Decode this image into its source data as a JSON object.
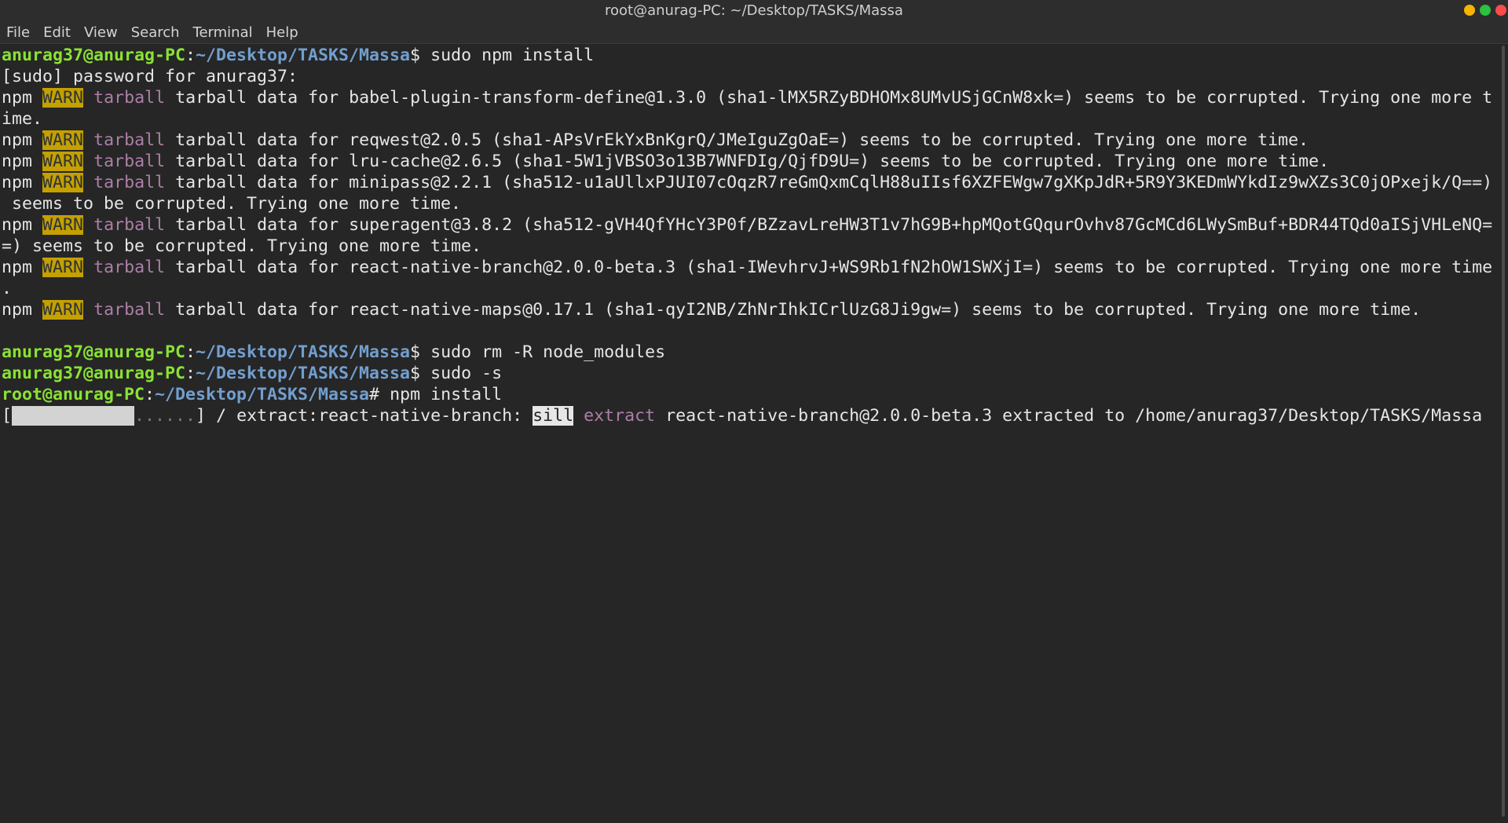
{
  "window": {
    "title": "root@anurag-PC: ~/Desktop/TASKS/Massa",
    "controls": [
      {
        "name": "minimize",
        "color": "#f7b500"
      },
      {
        "name": "maximize",
        "color": "#29c241"
      },
      {
        "name": "close",
        "color": "#fd4b4b"
      }
    ]
  },
  "menu": [
    "File",
    "Edit",
    "View",
    "Search",
    "Terminal",
    "Help"
  ],
  "colors": {
    "user_prompt": "#8ae234",
    "path": "#729fcf",
    "warn_bg": "#c4a000",
    "tarball": "#ad7fa8"
  },
  "terminal": {
    "lines": [
      {
        "type": "prompt",
        "user": "anurag37@anurag-PC",
        "path": "~/Desktop/TASKS/Massa",
        "symbol": "$",
        "cmd": " sudo npm install"
      },
      {
        "type": "plain",
        "text": "[sudo] password for anurag37:"
      },
      {
        "type": "warn",
        "pre": "npm",
        "level": "WARN",
        "tag": "tarball",
        "msg": " tarball data for babel-plugin-transform-define@1.3.0 (sha1-lMX5RZyBDHOMx8UMvUSjGCnW8xk=) seems to be corrupted. Trying one more t"
      },
      {
        "type": "plain",
        "text": "ime."
      },
      {
        "type": "warn",
        "pre": "npm",
        "level": "WARN",
        "tag": "tarball",
        "msg": " tarball data for reqwest@2.0.5 (sha1-APsVrEkYxBnKgrQ/JMeIguZgOaE=) seems to be corrupted. Trying one more time."
      },
      {
        "type": "warn",
        "pre": "npm",
        "level": "WARN",
        "tag": "tarball",
        "msg": " tarball data for lru-cache@2.6.5 (sha1-5W1jVBSO3o13B7WNFDIg/QjfD9U=) seems to be corrupted. Trying one more time."
      },
      {
        "type": "warn",
        "pre": "npm",
        "level": "WARN",
        "tag": "tarball",
        "msg": " tarball data for minipass@2.2.1 (sha512-u1aUllxPJUI07cOqzR7reGmQxmCqlH88uIIsf6XZFEWgw7gXKpJdR+5R9Y3KEDmWYkdIz9wXZs3C0jOPxejk/Q==)"
      },
      {
        "type": "plain",
        "text": " seems to be corrupted. Trying one more time."
      },
      {
        "type": "warn",
        "pre": "npm",
        "level": "WARN",
        "tag": "tarball",
        "msg": " tarball data for superagent@3.8.2 (sha512-gVH4QfYHcY3P0f/BZzavLreHW3T1v7hG9B+hpMQotGQqurOvhv87GcMCd6LWySmBuf+BDR44TQd0aISjVHLeNQ="
      },
      {
        "type": "plain",
        "text": "=) seems to be corrupted. Trying one more time."
      },
      {
        "type": "warn",
        "pre": "npm",
        "level": "WARN",
        "tag": "tarball",
        "msg": " tarball data for react-native-branch@2.0.0-beta.3 (sha1-IWevhrvJ+WS9Rb1fN2hOW1SWXjI=) seems to be corrupted. Trying one more time"
      },
      {
        "type": "plain",
        "text": "."
      },
      {
        "type": "warn",
        "pre": "npm",
        "level": "WARN",
        "tag": "tarball",
        "msg": " tarball data for react-native-maps@0.17.1 (sha1-qyI2NB/ZhNrIhkICrlUzG8Ji9gw=) seems to be corrupted. Trying one more time."
      },
      {
        "type": "plain",
        "text": ""
      },
      {
        "type": "prompt",
        "user": "anurag37@anurag-PC",
        "path": "~/Desktop/TASKS/Massa",
        "symbol": "$",
        "cmd": " sudo rm -R node_modules"
      },
      {
        "type": "prompt",
        "user": "anurag37@anurag-PC",
        "path": "~/Desktop/TASKS/Massa",
        "symbol": "$",
        "cmd": " sudo -s"
      },
      {
        "type": "prompt",
        "user": "root@anurag-PC",
        "path": "~/Desktop/TASKS/Massa",
        "symbol": "#",
        "cmd": " npm install"
      },
      {
        "type": "progress",
        "open": "[",
        "filled": "############",
        "dots": "......",
        "close": "]",
        "mid": " / extract:react-native-branch: ",
        "sill": "sill",
        "extract": " extract",
        "tail": " react-native-branch@2.0.0-beta.3 extracted to /home/anurag37/Desktop/TASKS/Massa"
      }
    ]
  }
}
